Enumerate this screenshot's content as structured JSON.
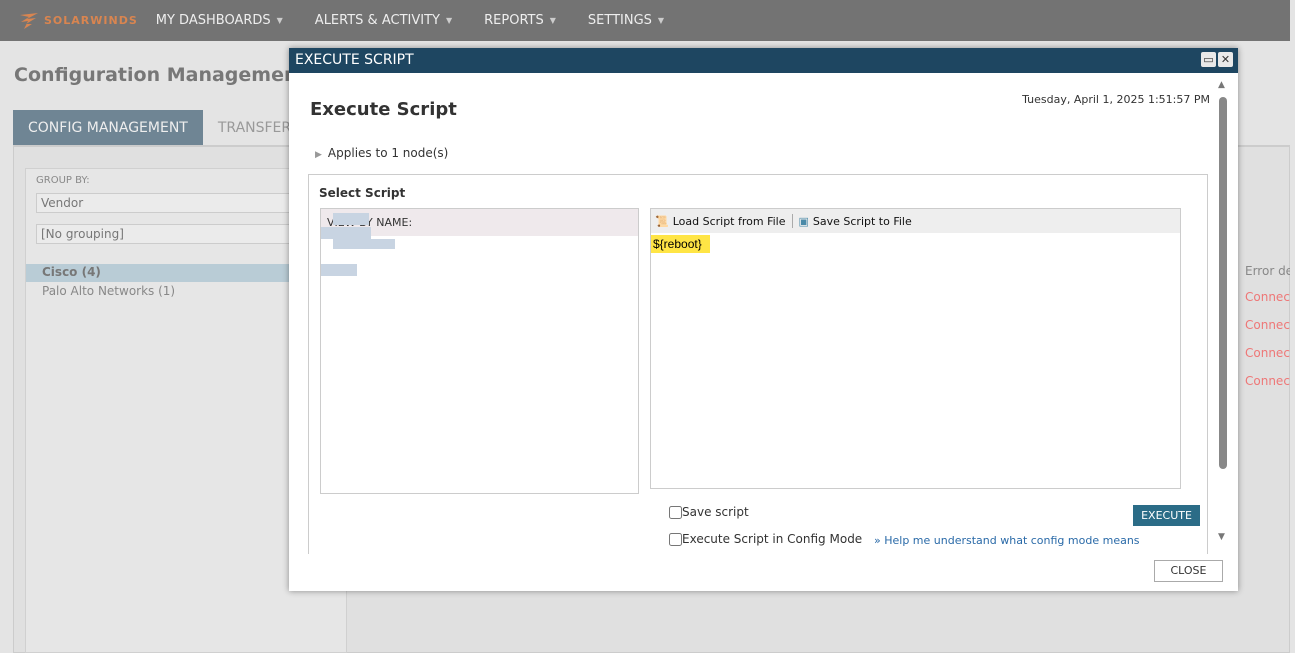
{
  "topbar": {
    "brand": "SOLARWINDS",
    "nav": [
      "MY DASHBOARDS",
      "ALERTS & ACTIVITY",
      "REPORTS",
      "SETTINGS"
    ]
  },
  "page": {
    "title": "Configuration Management",
    "tabs": [
      "CONFIG MANAGEMENT",
      "TRANSFER S"
    ]
  },
  "left": {
    "group_by_label": "GROUP BY:",
    "group_by_value": "Vendor",
    "grouping_value": "[No grouping]",
    "tree": [
      {
        "label": "Cisco (4)"
      },
      {
        "label": "Palo Alto Networks (1)"
      }
    ]
  },
  "right": {
    "header": "Error de",
    "rows": [
      "Connect",
      "Connect",
      "Connect",
      "Connect"
    ]
  },
  "modal": {
    "header": "EXECUTE SCRIPT",
    "title": "Execute Script",
    "date": "Tuesday, April 1, 2025 1:51:57 PM",
    "applies": "Applies to 1 node(s)",
    "select_script": "Select Script",
    "view_by": "VIEW BY NAME:",
    "load": "Load Script from File",
    "save_file": "Save Script to File",
    "script": "${reboot}",
    "save_script": "Save script",
    "config_mode": "Execute Script in Config Mode",
    "help": "» Help me understand what config mode means",
    "execute": "EXECUTE",
    "close": "CLOSE"
  }
}
